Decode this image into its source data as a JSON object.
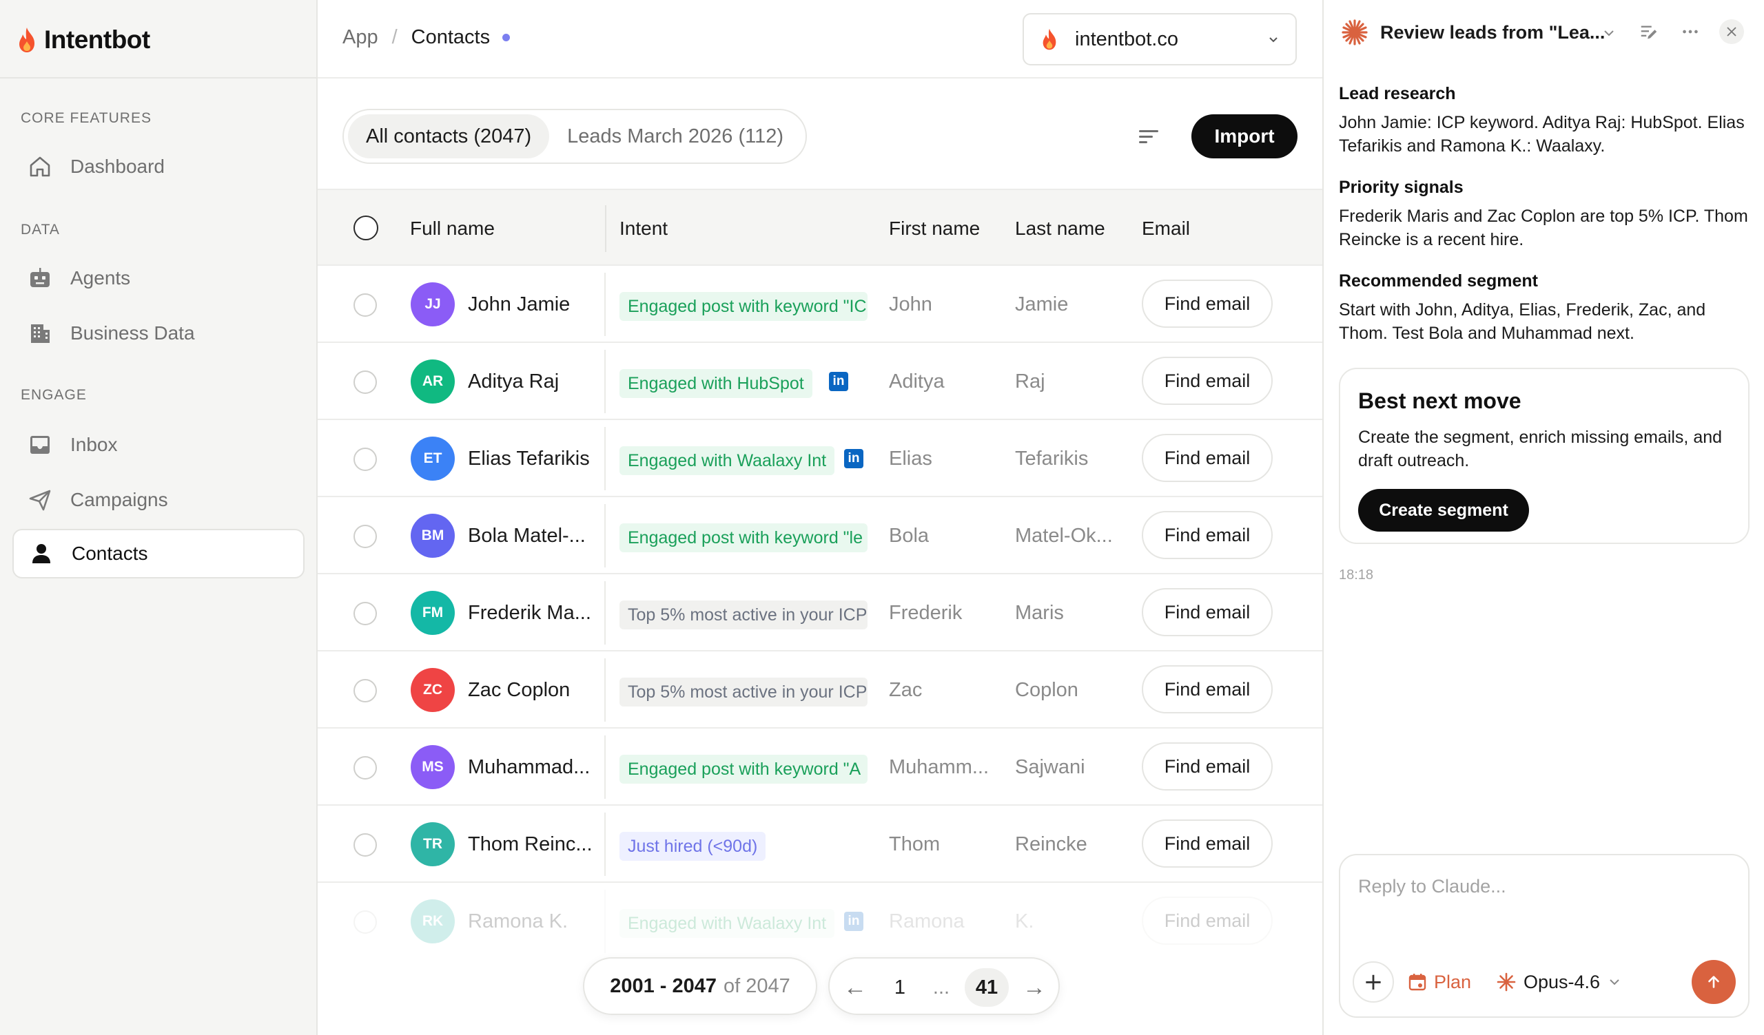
{
  "brand": {
    "name": "Intentbot"
  },
  "sidebar": {
    "sections": [
      {
        "label": "CORE FEATURES",
        "items": [
          {
            "label": "Dashboard",
            "icon": "home-icon",
            "active": false
          }
        ]
      },
      {
        "label": "DATA",
        "items": [
          {
            "label": "Agents",
            "icon": "robot-icon",
            "active": false
          },
          {
            "label": "Business Data",
            "icon": "building-icon",
            "active": false
          }
        ]
      },
      {
        "label": "ENGAGE",
        "items": [
          {
            "label": "Inbox",
            "icon": "inbox-icon",
            "active": false
          },
          {
            "label": "Campaigns",
            "icon": "send-icon",
            "active": false
          },
          {
            "label": "Contacts",
            "icon": "person-icon",
            "active": true
          }
        ]
      }
    ]
  },
  "header": {
    "breadcrumb": {
      "root": "App",
      "separator": "/",
      "current": "Contacts"
    },
    "workspace": "intentbot.co"
  },
  "tabs": [
    {
      "label": "All contacts (2047)",
      "active": true
    },
    {
      "label": "Leads March 2026 (112)",
      "active": false
    }
  ],
  "import_label": "Import",
  "table": {
    "columns": [
      "Full name",
      "Intent",
      "First name",
      "Last name",
      "Email"
    ],
    "find_email_label": "Find email",
    "rows": [
      {
        "initials": "JJ",
        "avatar_color": "#8b5cf6",
        "full_name": "John Jamie",
        "intent": "Engaged post with keyword \"IC",
        "intent_style": "green",
        "linkedin": false,
        "first_name": "John",
        "last_name": "Jamie"
      },
      {
        "initials": "AR",
        "avatar_color": "#10b981",
        "full_name": "Aditya Raj",
        "intent": "Engaged with HubSpot",
        "intent_style": "green",
        "linkedin": true,
        "first_name": "Aditya",
        "last_name": "Raj"
      },
      {
        "initials": "ET",
        "avatar_color": "#3b82f6",
        "full_name": "Elias Tefarikis",
        "intent": "Engaged with Waalaxy Int",
        "intent_style": "green",
        "linkedin": true,
        "first_name": "Elias",
        "last_name": "Tefarikis"
      },
      {
        "initials": "BM",
        "avatar_color": "#6366f1",
        "full_name": "Bola Matel-...",
        "intent": "Engaged post with keyword \"le",
        "intent_style": "green",
        "linkedin": false,
        "first_name": "Bola",
        "last_name": "Matel-Ok..."
      },
      {
        "initials": "FM",
        "avatar_color": "#14b8a6",
        "full_name": "Frederik Ma...",
        "intent": "Top 5% most active in your ICP",
        "intent_style": "gray",
        "linkedin": false,
        "first_name": "Frederik",
        "last_name": "Maris"
      },
      {
        "initials": "ZC",
        "avatar_color": "#ef4444",
        "full_name": "Zac Coplon",
        "intent": "Top 5% most active in your ICP",
        "intent_style": "gray",
        "linkedin": false,
        "first_name": "Zac",
        "last_name": "Coplon"
      },
      {
        "initials": "MS",
        "avatar_color": "#8b5cf6",
        "full_name": "Muhammad...",
        "intent": "Engaged post with keyword \"A",
        "intent_style": "green",
        "linkedin": false,
        "first_name": "Muhamm...",
        "last_name": "Sajwani"
      },
      {
        "initials": "TR",
        "avatar_color": "#2fb5a6",
        "full_name": "Thom Reinc...",
        "intent": "Just hired (<90d)",
        "intent_style": "purple",
        "linkedin": false,
        "first_name": "Thom",
        "last_name": "Reincke"
      },
      {
        "initials": "RK",
        "avatar_color": "#2fb5a6",
        "full_name": "Ramona K.",
        "intent": "Engaged with Waalaxy Int",
        "intent_style": "green",
        "linkedin": true,
        "first_name": "Ramona",
        "last_name": "K."
      }
    ]
  },
  "pagination": {
    "range": "2001 - 2047",
    "of_label": "of 2047",
    "first_page": "1",
    "ellipsis": "...",
    "current_page": "41",
    "prev": "←",
    "next": "→"
  },
  "chat": {
    "title": "Review leads from \"Lea...",
    "messages": [
      {
        "heading": "Lead research",
        "text": "John Jamie: ICP keyword. Aditya Raj: HubSpot. Elias Tefarikis and Ramona K.: Waalaxy."
      },
      {
        "heading": "Priority signals",
        "text": "Frederik Maris and Zac Coplon are top 5% ICP. Thom Reincke is a recent hire."
      },
      {
        "heading": "Recommended segment",
        "text": "Start with John, Aditya, Elias, Frederik, Zac, and Thom. Test Bola and Muhammad next."
      }
    ],
    "card": {
      "title": "Best next move",
      "text": "Create the segment, enrich missing emails, and draft outreach.",
      "button": "Create segment"
    },
    "timestamp": "18:18",
    "composer": {
      "placeholder": "Reply to Claude...",
      "plan_label": "Plan",
      "model_label": "Opus-4.6"
    }
  },
  "colors": {
    "accent": "#d9623f",
    "brand_flame": "#f5532d",
    "primary_button": "#0d0d0d",
    "intent_green": "#1aa05a",
    "linkedin": "#0a66c2"
  }
}
